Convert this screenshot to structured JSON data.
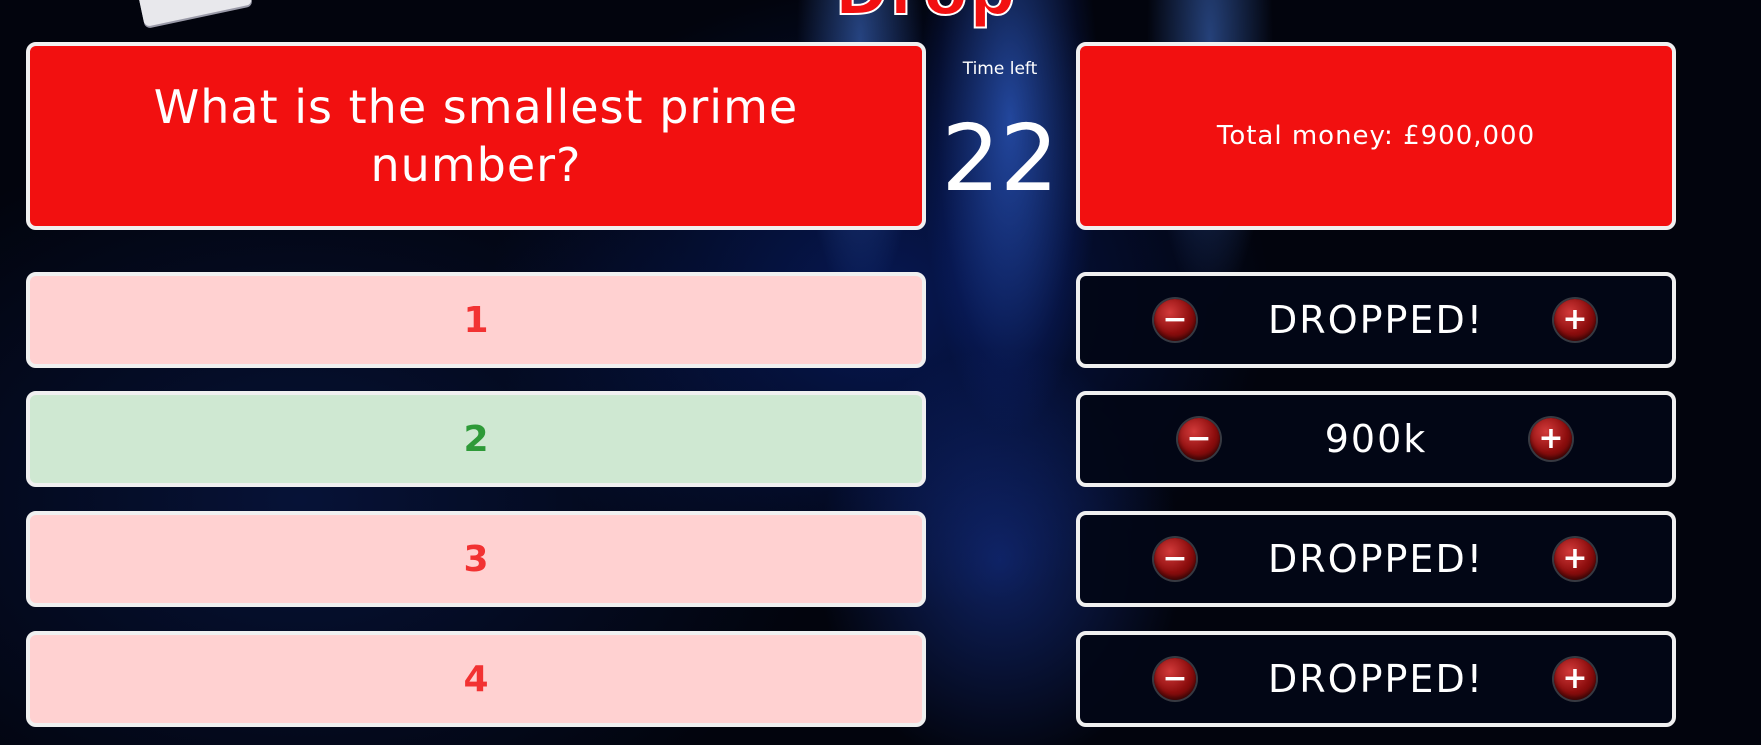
{
  "logo": {
    "text": "Drop"
  },
  "question": {
    "text": "What is the smallest prime number?"
  },
  "timer": {
    "label": "Time left",
    "value": "22"
  },
  "money": {
    "text": "Total money: £900,000"
  },
  "answers": [
    {
      "label": "1",
      "status": "incorrect"
    },
    {
      "label": "2",
      "status": "correct"
    },
    {
      "label": "3",
      "status": "incorrect"
    },
    {
      "label": "4",
      "status": "incorrect"
    }
  ],
  "stakes": [
    {
      "text": "DROPPED!"
    },
    {
      "text": "900k"
    },
    {
      "text": "DROPPED!"
    },
    {
      "text": "DROPPED!"
    }
  ],
  "controls": {
    "minus": "−",
    "plus": "+"
  },
  "colors": {
    "accent_red": "#f21010",
    "incorrect_bg": "#ffd1d1",
    "incorrect_text": "#f23232",
    "correct_bg": "#cfe8d2",
    "correct_text": "#2e9a38",
    "stake_bg": "#020616"
  }
}
